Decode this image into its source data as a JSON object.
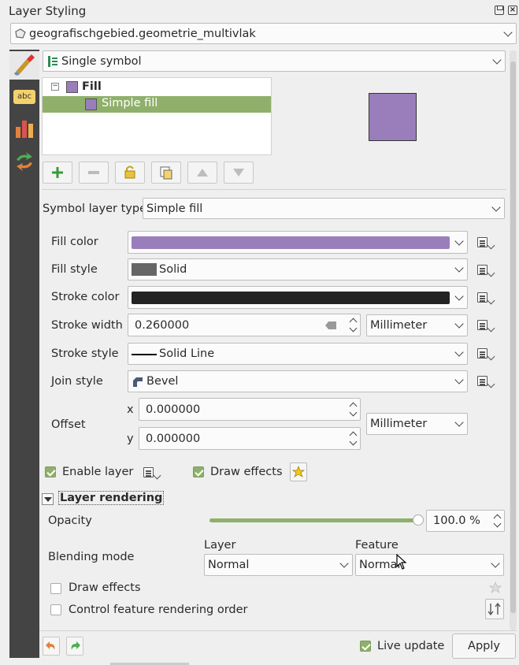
{
  "panel": {
    "title": "Layer Styling",
    "float_icon": "restore-icon",
    "close_icon": "close-icon"
  },
  "layer_select": {
    "value": "geografischgebied.geometrie_multivlak",
    "icon": "polygon-layer-icon"
  },
  "left_tabs": [
    "symbology-tab-icon",
    "labels-tab-icon",
    "diagrams-tab-icon",
    "history-tab-icon"
  ],
  "renderer": {
    "value": "Single symbol"
  },
  "tree": {
    "root": "Fill",
    "child": "Simple fill"
  },
  "preview": {
    "color": "#9a7ebc"
  },
  "toolbar": [
    "add-layer-icon",
    "remove-layer-icon",
    "lock-icon",
    "duplicate-icon",
    "move-up-icon",
    "move-down-icon"
  ],
  "symbol_layer_type": {
    "label": "Symbol layer type",
    "value": "Simple fill"
  },
  "fill_color": {
    "label": "Fill color",
    "color": "#9a7ebc"
  },
  "fill_style": {
    "label": "Fill style",
    "value": "Solid"
  },
  "stroke_color": {
    "label": "Stroke color",
    "color": "#232323"
  },
  "stroke_width": {
    "label": "Stroke width",
    "value": "0.260000",
    "unit": "Millimeter"
  },
  "stroke_style": {
    "label": "Stroke style",
    "value": "Solid Line"
  },
  "join_style": {
    "label": "Join style",
    "value": "Bevel"
  },
  "offset": {
    "label": "Offset",
    "x_label": "x",
    "x": "0.000000",
    "y_label": "y",
    "y": "0.000000",
    "unit": "Millimeter"
  },
  "enable_layer": {
    "label": "Enable layer",
    "checked": true
  },
  "draw_effects": {
    "label": "Draw effects",
    "checked": true
  },
  "layer_rendering": {
    "title": "Layer rendering",
    "opacity_label": "Opacity",
    "opacity_value": "100.0 %",
    "opacity_fraction": 1.0,
    "blending_label": "Blending mode",
    "layer_col": "Layer",
    "feature_col": "Feature",
    "layer_blend": "Normal",
    "feature_blend": "Normal",
    "draw_effects_label": "Draw effects",
    "order_label": "Control feature rendering order"
  },
  "footer": {
    "live_update": "Live update",
    "apply": "Apply"
  },
  "colors": {
    "accent_green": "#8fb06a",
    "sidebar": "#444444"
  }
}
